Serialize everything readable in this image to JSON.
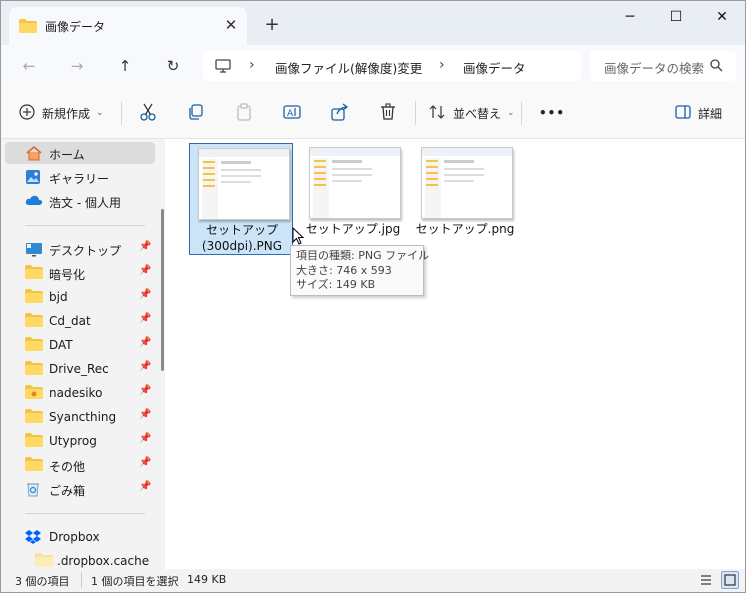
{
  "window": {
    "tab_title": "画像データ",
    "new_tab_label": "+",
    "minimize_label": "─",
    "maximize_label": "☐",
    "close_label": "✕",
    "tab_close_label": "✕"
  },
  "nav": {
    "back": "←",
    "forward": "→",
    "up": "↑",
    "refresh": "↻"
  },
  "breadcrumb": {
    "items": [
      "画像ファイル(解像度)変更",
      "画像データ"
    ],
    "separator": "›"
  },
  "search": {
    "placeholder": "画像データの検索"
  },
  "command_bar": {
    "new_label": "新規作成",
    "sort_label": "並べ替え",
    "more_label": "•••",
    "details_label": "詳細"
  },
  "sidebar": {
    "items": [
      {
        "label": "ホーム",
        "icon": "home-icon"
      },
      {
        "label": "ギャラリー",
        "icon": "gallery-icon"
      },
      {
        "label": "浩文 - 個人用",
        "icon": "onedrive-icon"
      },
      {
        "label": "デスクトップ",
        "icon": "desktop-icon"
      },
      {
        "label": "暗号化",
        "icon": "folder-icon"
      },
      {
        "label": "bjd",
        "icon": "folder-icon"
      },
      {
        "label": "Cd_dat",
        "icon": "folder-icon"
      },
      {
        "label": "DAT",
        "icon": "folder-icon"
      },
      {
        "label": "Drive_Rec",
        "icon": "folder-icon"
      },
      {
        "label": "nadesiko",
        "icon": "folder-icon"
      },
      {
        "label": "Syancthing",
        "icon": "folder-icon"
      },
      {
        "label": "Utyprog",
        "icon": "folder-icon"
      },
      {
        "label": "その他",
        "icon": "folder-icon"
      },
      {
        "label": "ごみ箱",
        "icon": "recycle-bin-icon"
      },
      {
        "label": "Dropbox",
        "icon": "dropbox-icon"
      },
      {
        "label": ".dropbox.cache",
        "icon": "folder-icon"
      }
    ]
  },
  "files": [
    {
      "name_line1": "セットアップ",
      "name_line2": "(300dpi).PNG",
      "selected": true
    },
    {
      "name_line1": "セットアップ.jpg",
      "name_line2": "",
      "selected": false
    },
    {
      "name_line1": "セットアップ.png",
      "name_line2": "",
      "selected": false
    }
  ],
  "tooltip": {
    "type_line": "項目の種類: PNG ファイル",
    "size_line": "大きさ: 746 x 593",
    "filesize_line": "サイズ: 149 KB"
  },
  "status": {
    "item_count": "3 個の項目",
    "selection": "1 個の項目を選択",
    "selection_size": "149 KB"
  },
  "colors": {
    "accent": "#0f6cbd",
    "selection_bg": "#cce4f7",
    "folder": "#f4c542"
  }
}
